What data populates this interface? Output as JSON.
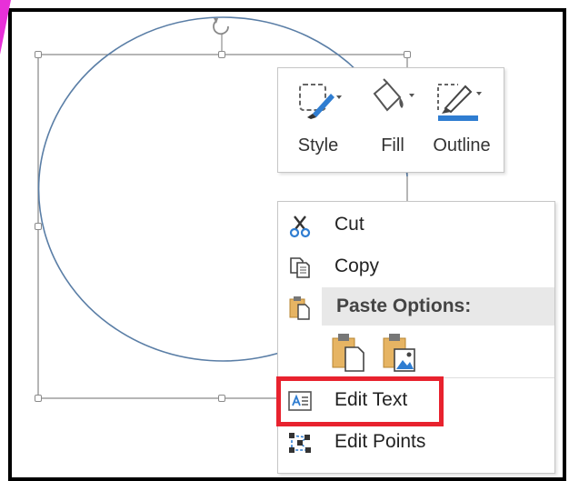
{
  "mini_toolbar": {
    "style_label": "Style",
    "fill_label": "Fill",
    "outline_label": "Outline"
  },
  "context_menu": {
    "cut_label": "Cut",
    "copy_label": "Copy",
    "paste_options_label": "Paste Options:",
    "edit_text_label": "Edit Text",
    "edit_points_label": "Edit Points"
  },
  "icons": {
    "rotate": "rotate-handle-icon",
    "style": "shape-style-icon",
    "fill": "paint-bucket-icon",
    "outline": "outline-pen-icon",
    "cut": "scissors-icon",
    "copy": "copy-icon",
    "paste_header": "clipboard-icon",
    "paste_keep": "paste-keep-source-icon",
    "paste_picture": "paste-picture-icon",
    "edit_text": "edit-text-icon",
    "edit_points": "edit-points-icon"
  },
  "colors": {
    "shape_stroke": "#5a7ea6",
    "highlight": "#e8222e",
    "accent_blue": "#2f7dd1",
    "clipboard_tan": "#e6b463"
  }
}
